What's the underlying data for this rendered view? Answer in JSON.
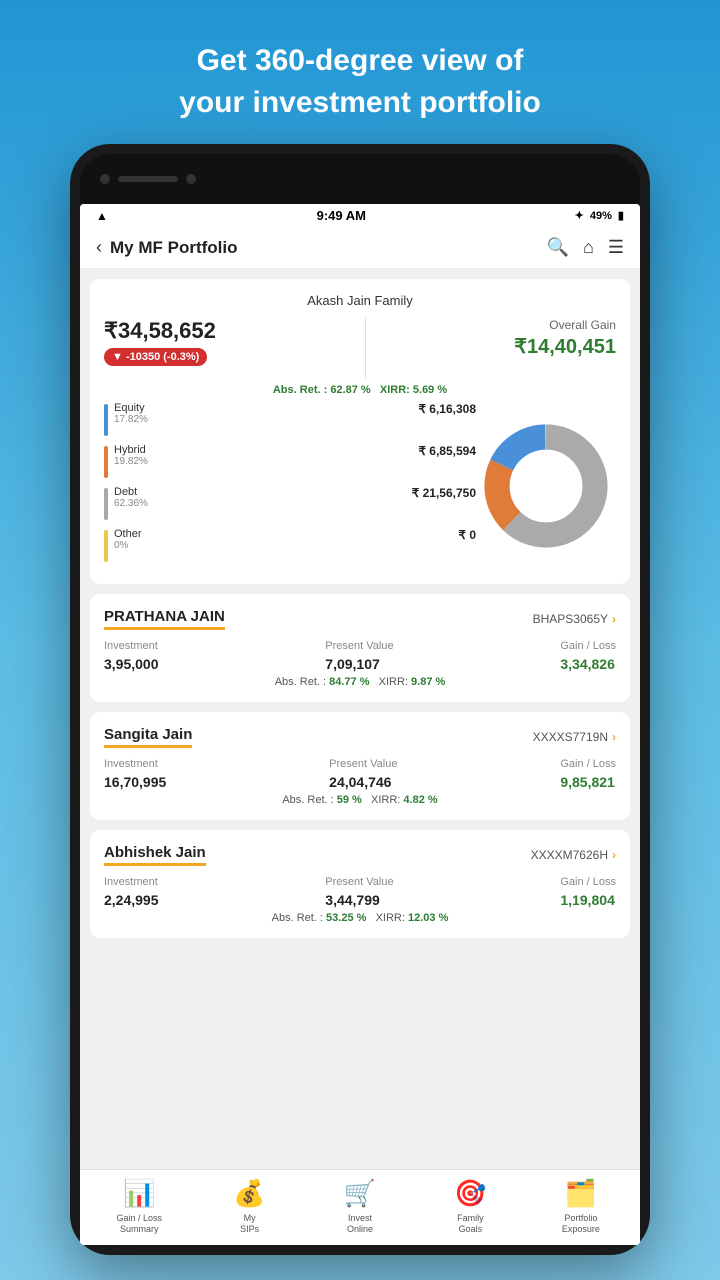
{
  "page": {
    "bg_headline1": "Get 360-degree view of",
    "bg_headline2": "your investment portfolio"
  },
  "status_bar": {
    "time": "9:49 AM",
    "battery": "49%",
    "bluetooth": "BT"
  },
  "nav": {
    "title": "My MF Portfolio",
    "back_label": "‹"
  },
  "portfolio": {
    "family_name": "Akash Jain Family",
    "total_value": "₹34,58,652",
    "change": "▼ -10350  (-0.3%)",
    "overall_gain_label": "Overall Gain",
    "overall_gain_value": "₹14,40,451",
    "abs_ret_label": "Abs. Ret. :",
    "abs_ret_value": "62.87 %",
    "xirr_label": "XIRR:",
    "xirr_value": "5.69 %",
    "segments": [
      {
        "name": "Equity",
        "pct": "17.82%",
        "amount": "₹ 6,16,308",
        "color": "#4a90d9"
      },
      {
        "name": "Hybrid",
        "pct": "19.82%",
        "amount": "₹ 6,85,594",
        "color": "#e07b39"
      },
      {
        "name": "Debt",
        "pct": "62.36%",
        "amount": "₹ 21,56,750",
        "color": "#aaaaaa"
      },
      {
        "name": "Other",
        "pct": "0%",
        "amount": "₹ 0",
        "color": "#e6c84a"
      }
    ]
  },
  "persons": [
    {
      "name": "PRATHANA JAIN",
      "pan": "BHAPS3065Y",
      "investment": "3,95,000",
      "present_value": "7,09,107",
      "gain_loss": "3,34,826",
      "abs_ret": "84.77 %",
      "xirr": "9.87 %"
    },
    {
      "name": "Sangita Jain",
      "pan": "XXXXS7719N",
      "investment": "16,70,995",
      "present_value": "24,04,746",
      "gain_loss": "9,85,821",
      "abs_ret": "59 %",
      "xirr": "4.82 %"
    },
    {
      "name": "Abhishek Jain",
      "pan": "XXXXM7626H",
      "investment": "2,24,995",
      "present_value": "3,44,799",
      "gain_loss": "1,19,804",
      "abs_ret": "53.25 %",
      "xirr": "12.03 %"
    }
  ],
  "bottom_nav": [
    {
      "id": "gain-loss",
      "label": "Gain / Loss\nSummary",
      "icon": "📊"
    },
    {
      "id": "my-sips",
      "label": "My\nSIPs",
      "icon": "💰"
    },
    {
      "id": "invest",
      "label": "Invest\nOnline",
      "icon": "🛒"
    },
    {
      "id": "family",
      "label": "Family\nGoals",
      "icon": "🎯"
    },
    {
      "id": "portfolio",
      "label": "Portfolio\nExposure",
      "icon": "🗂️"
    }
  ]
}
